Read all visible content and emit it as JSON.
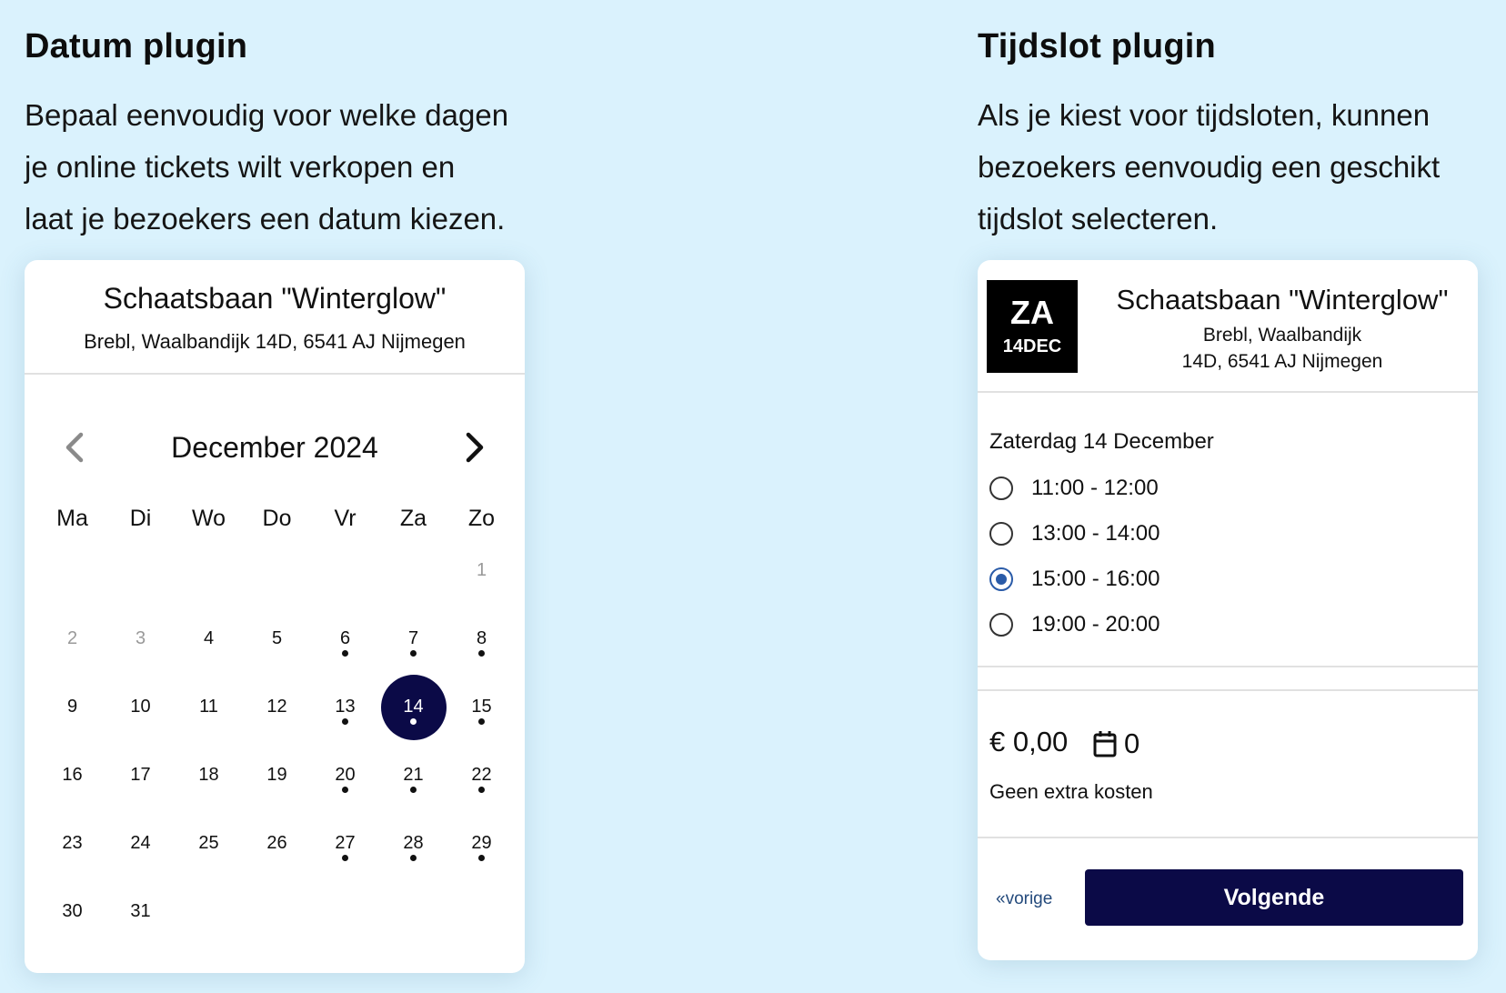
{
  "left": {
    "heading": "Datum plugin",
    "intro_lines": [
      "Bepaal eenvoudig voor welke dagen",
      "je online tickets wilt verkopen en",
      "laat je bezoekers een datum kiezen."
    ]
  },
  "right": {
    "heading": "Tijdslot plugin",
    "intro_lines": [
      "Als je kiest voor tijdsloten, kunnen",
      "bezoekers eenvoudig een geschikt",
      "tijdslot selecteren."
    ]
  },
  "calendar_card": {
    "venue_title": "Schaatsbaan \"Winterglow\"",
    "venue_address": "Brebl, Waalbandijk 14D, 6541 AJ Nijmegen",
    "month_label": "December 2024",
    "weekdays": [
      "Ma",
      "Di",
      "Wo",
      "Do",
      "Vr",
      "Za",
      "Zo"
    ],
    "weeks": [
      [
        null,
        null,
        null,
        null,
        null,
        null,
        {
          "n": "1",
          "muted": true
        }
      ],
      [
        {
          "n": "2",
          "muted": true
        },
        {
          "n": "3",
          "muted": true
        },
        {
          "n": "4"
        },
        {
          "n": "5"
        },
        {
          "n": "6",
          "dot": true
        },
        {
          "n": "7",
          "dot": true
        },
        {
          "n": "8",
          "dot": true
        }
      ],
      [
        {
          "n": "9"
        },
        {
          "n": "10"
        },
        {
          "n": "11"
        },
        {
          "n": "12"
        },
        {
          "n": "13",
          "dot": true
        },
        {
          "n": "14",
          "dot": true,
          "selected": true
        },
        {
          "n": "15",
          "dot": true
        }
      ],
      [
        {
          "n": "16"
        },
        {
          "n": "17"
        },
        {
          "n": "18"
        },
        {
          "n": "19"
        },
        {
          "n": "20",
          "dot": true
        },
        {
          "n": "21",
          "dot": true
        },
        {
          "n": "22",
          "dot": true
        }
      ],
      [
        {
          "n": "23"
        },
        {
          "n": "24"
        },
        {
          "n": "25"
        },
        {
          "n": "26"
        },
        {
          "n": "27",
          "dot": true
        },
        {
          "n": "28",
          "dot": true
        },
        {
          "n": "29",
          "dot": true
        }
      ],
      [
        {
          "n": "30"
        },
        {
          "n": "31"
        },
        null,
        null,
        null,
        null,
        null
      ]
    ],
    "selected_color": "#0b0a47"
  },
  "slot_card": {
    "badge_day": "ZA",
    "badge_date": "14DEC",
    "venue_title": "Schaatsbaan \"Winterglow\"",
    "venue_address_line1": "Brebl, Waalbandijk",
    "venue_address_line2": "14D, 6541 AJ Nijmegen",
    "day_label": "Zaterdag 14 December",
    "slots": [
      {
        "label": "11:00 - 12:00",
        "selected": false
      },
      {
        "label": "13:00 - 14:00",
        "selected": false
      },
      {
        "label": "15:00 - 16:00",
        "selected": true
      },
      {
        "label": "19:00 - 20:00",
        "selected": false
      }
    ],
    "price": "€ 0,00",
    "basket_icon": "basket-icon",
    "basket_count": "0",
    "fee_note": "Geen extra kosten",
    "prev_label": "«vorige",
    "next_label": "Volgende",
    "accent_color": "#0b0a47",
    "radio_color": "#2a5ba8"
  },
  "background_color": "#daf2fd"
}
